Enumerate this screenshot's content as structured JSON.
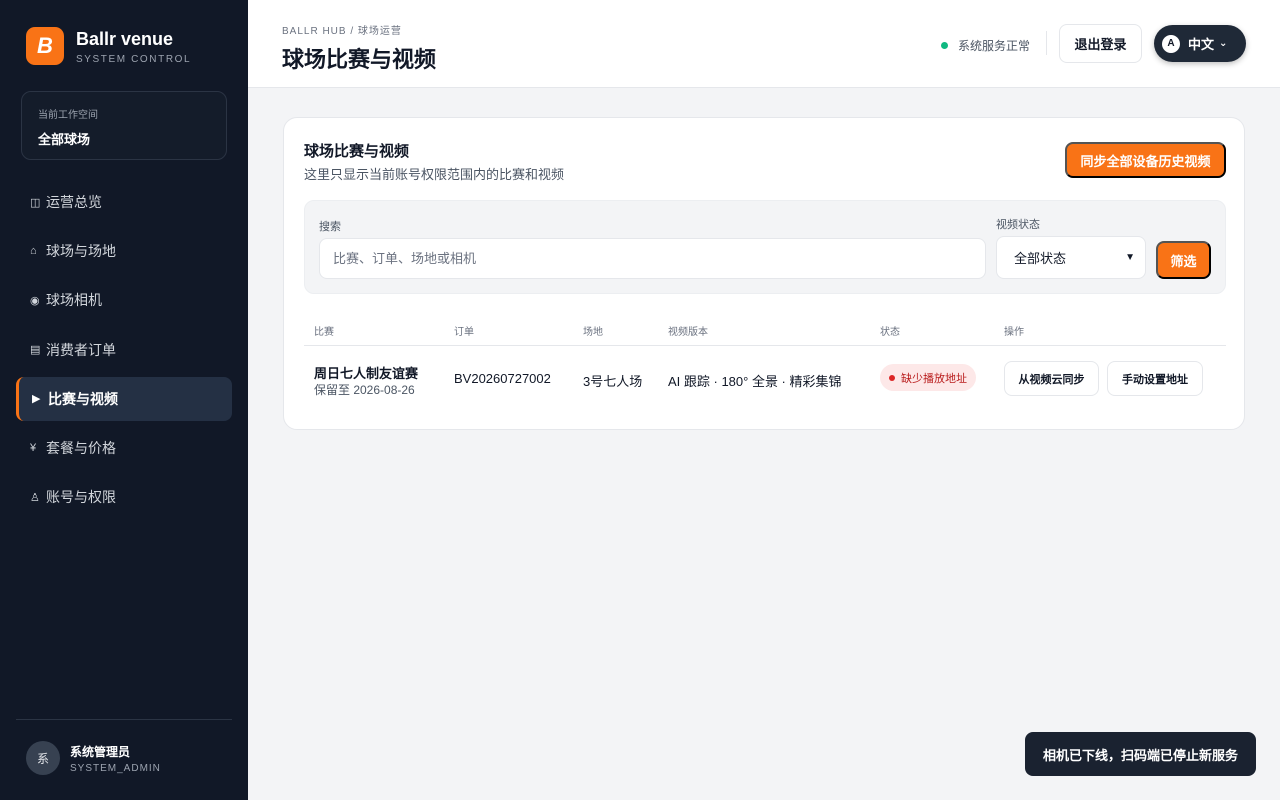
{
  "brand": {
    "logo_letter": "B",
    "name": "Ballr venue",
    "subtitle": "SYSTEM CONTROL",
    "color": "#f97316"
  },
  "workspace": {
    "label": "当前工作空间",
    "value": "全部球场"
  },
  "nav": [
    {
      "icon": "◫",
      "label": "运营总览",
      "icon_name": "overview-icon",
      "active": false
    },
    {
      "icon": "⌂",
      "label": "球场与场地",
      "icon_name": "home-icon",
      "active": false
    },
    {
      "icon": "◉",
      "label": "球场相机",
      "icon_name": "camera-icon",
      "active": false
    },
    {
      "icon": "▤",
      "label": "消费者订单",
      "icon_name": "orders-icon",
      "active": false
    },
    {
      "icon": "▶",
      "label": "比赛与视频",
      "icon_name": "play-icon",
      "active": true
    },
    {
      "icon": "¥",
      "label": "套餐与价格",
      "icon_name": "yen-icon",
      "active": false
    },
    {
      "icon": "♙",
      "label": "账号与权限",
      "icon_name": "user-icon",
      "active": false
    }
  ],
  "user": {
    "avatar": "系",
    "name": "系统管理员",
    "role": "SYSTEM_ADMIN"
  },
  "header": {
    "breadcrumb": "BALLR HUB / 球场运营",
    "title": "球场比赛与视频",
    "status": "系统服务正常",
    "status_color": "#10b981",
    "logout": "退出登录",
    "lang_badge": "A",
    "lang": "中文"
  },
  "card": {
    "title": "球场比赛与视频",
    "subtitle": "这里只显示当前账号权限范围内的比赛和视频",
    "sync_button": "同步全部设备历史视频"
  },
  "filter": {
    "search_label": "搜索",
    "search_placeholder": "比赛、订单、场地或相机",
    "status_label": "视频状态",
    "status_value": "全部状态",
    "filter_button": "筛选"
  },
  "table": {
    "columns": [
      "比赛",
      "订单",
      "场地",
      "视频版本",
      "状态",
      "操作"
    ],
    "rows": [
      {
        "match": "周日七人制友谊赛",
        "retain": "保留至 2026-08-26",
        "order": "BV20260727002",
        "field": "3号七人场",
        "video": "AI 跟踪 · 180° 全景 · 精彩集锦",
        "status": "缺少播放地址",
        "status_color": "#dc2626",
        "actions": [
          "从视频云同步",
          "手动设置地址"
        ]
      }
    ]
  },
  "toast": "相机已下线，扫码端已停止新服务"
}
